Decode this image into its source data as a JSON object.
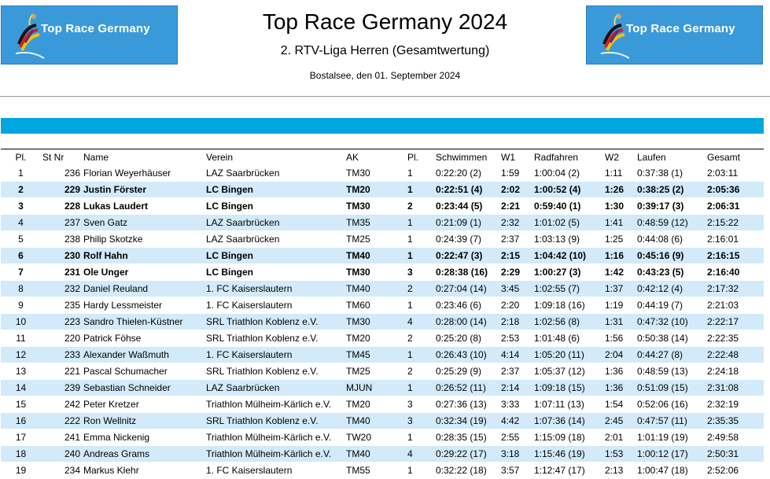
{
  "header": {
    "logo_text": "Top Race Germany",
    "title": "Top Race Germany 2024",
    "subtitle": "2. RTV-Liga Herren (Gesamtwertung)",
    "place_date": "Bostalsee, den 01. September 2024"
  },
  "columns": [
    "Pl.",
    "St Nr",
    "Name",
    "Verein",
    "AK",
    "Pl.",
    "Schwimmen",
    "W1",
    "Radfahren",
    "W2",
    "Laufen",
    "Gesamt"
  ],
  "rows": [
    {
      "pl": "1",
      "st": "236",
      "name": "Florian Weyerhäuser",
      "verein": "LAZ Saarbrücken",
      "ak": "TM30",
      "akpl": "1",
      "schwimmen": "0:22:20 (2)",
      "w1": "1:59",
      "rad": "1:00:04 (2)",
      "w2": "1:11",
      "laufen": "0:37:38 (1)",
      "gesamt": "2:03:11",
      "bold": false,
      "alt": false
    },
    {
      "pl": "2",
      "st": "229",
      "name": "Justin Förster",
      "verein": "LC Bingen",
      "ak": "TM20",
      "akpl": "1",
      "schwimmen": "0:22:51 (4)",
      "w1": "2:02",
      "rad": "1:00:52 (4)",
      "w2": "1:26",
      "laufen": "0:38:25 (2)",
      "gesamt": "2:05:36",
      "bold": true,
      "alt": true
    },
    {
      "pl": "3",
      "st": "228",
      "name": "Lukas Laudert",
      "verein": "LC Bingen",
      "ak": "TM30",
      "akpl": "2",
      "schwimmen": "0:23:44 (5)",
      "w1": "2:21",
      "rad": "0:59:40 (1)",
      "w2": "1:30",
      "laufen": "0:39:17 (3)",
      "gesamt": "2:06:31",
      "bold": true,
      "alt": false
    },
    {
      "pl": "4",
      "st": "237",
      "name": "Sven Gatz",
      "verein": "LAZ Saarbrücken",
      "ak": "TM35",
      "akpl": "1",
      "schwimmen": "0:21:09 (1)",
      "w1": "2:32",
      "rad": "1:01:02 (5)",
      "w2": "1:41",
      "laufen": "0:48:59 (12)",
      "gesamt": "2:15:22",
      "bold": false,
      "alt": true
    },
    {
      "pl": "5",
      "st": "238",
      "name": "Philip Skotzke",
      "verein": "LAZ Saarbrücken",
      "ak": "TM25",
      "akpl": "1",
      "schwimmen": "0:24:39 (7)",
      "w1": "2:37",
      "rad": "1:03:13 (9)",
      "w2": "1:25",
      "laufen": "0:44:08 (6)",
      "gesamt": "2:16:01",
      "bold": false,
      "alt": false
    },
    {
      "pl": "6",
      "st": "230",
      "name": "Rolf Hahn",
      "verein": "LC Bingen",
      "ak": "TM40",
      "akpl": "1",
      "schwimmen": "0:22:47 (3)",
      "w1": "2:15",
      "rad": "1:04:42 (10)",
      "w2": "1:16",
      "laufen": "0:45:16 (9)",
      "gesamt": "2:16:15",
      "bold": true,
      "alt": true
    },
    {
      "pl": "7",
      "st": "231",
      "name": "Ole Unger",
      "verein": "LC Bingen",
      "ak": "TM30",
      "akpl": "3",
      "schwimmen": "0:28:38 (16)",
      "w1": "2:29",
      "rad": "1:00:27 (3)",
      "w2": "1:42",
      "laufen": "0:43:23 (5)",
      "gesamt": "2:16:40",
      "bold": true,
      "alt": false
    },
    {
      "pl": "8",
      "st": "232",
      "name": "Daniel Reuland",
      "verein": "1. FC Kaiserslautern",
      "ak": "TM40",
      "akpl": "2",
      "schwimmen": "0:27:04 (14)",
      "w1": "3:45",
      "rad": "1:02:55 (7)",
      "w2": "1:37",
      "laufen": "0:42:12 (4)",
      "gesamt": "2:17:32",
      "bold": false,
      "alt": true
    },
    {
      "pl": "9",
      "st": "235",
      "name": "Hardy Lessmeister",
      "verein": "1. FC Kaiserslautern",
      "ak": "TM60",
      "akpl": "1",
      "schwimmen": "0:23:46 (6)",
      "w1": "2:20",
      "rad": "1:09:18 (16)",
      "w2": "1:19",
      "laufen": "0:44:19 (7)",
      "gesamt": "2:21:03",
      "bold": false,
      "alt": false
    },
    {
      "pl": "10",
      "st": "223",
      "name": "Sandro Thielen-Küstner",
      "verein": "SRL Triathlon Koblenz e.V.",
      "ak": "TM30",
      "akpl": "4",
      "schwimmen": "0:28:00 (14)",
      "w1": "2:18",
      "rad": "1:02:56 (8)",
      "w2": "1:31",
      "laufen": "0:47:32 (10)",
      "gesamt": "2:22:17",
      "bold": false,
      "alt": true
    },
    {
      "pl": "11",
      "st": "220",
      "name": "Patrick Föhse",
      "verein": "SRL Triathlon Koblenz e.V.",
      "ak": "TM20",
      "akpl": "2",
      "schwimmen": "0:25:20 (8)",
      "w1": "2:53",
      "rad": "1:01:48 (6)",
      "w2": "1:56",
      "laufen": "0:50:38 (14)",
      "gesamt": "2:22:35",
      "bold": false,
      "alt": false
    },
    {
      "pl": "12",
      "st": "233",
      "name": "Alexander Waßmuth",
      "verein": "1. FC Kaiserslautern",
      "ak": "TM45",
      "akpl": "1",
      "schwimmen": "0:26:43 (10)",
      "w1": "4:14",
      "rad": "1:05:20 (11)",
      "w2": "2:04",
      "laufen": "0:44:27 (8)",
      "gesamt": "2:22:48",
      "bold": false,
      "alt": true
    },
    {
      "pl": "13",
      "st": "221",
      "name": "Pascal Schumacher",
      "verein": "SRL Triathlon Koblenz e.V.",
      "ak": "TM25",
      "akpl": "2",
      "schwimmen": "0:25:29 (9)",
      "w1": "2:37",
      "rad": "1:05:37 (12)",
      "w2": "1:36",
      "laufen": "0:48:59 (13)",
      "gesamt": "2:24:18",
      "bold": false,
      "alt": false
    },
    {
      "pl": "14",
      "st": "239",
      "name": "Sebastian Schneider",
      "verein": "LAZ Saarbrücken",
      "ak": "MJUN",
      "akpl": "1",
      "schwimmen": "0:26:52 (11)",
      "w1": "2:14",
      "rad": "1:09:18 (15)",
      "w2": "1:36",
      "laufen": "0:51:09 (15)",
      "gesamt": "2:31:08",
      "bold": false,
      "alt": true
    },
    {
      "pl": "15",
      "st": "242",
      "name": "Peter Kretzer",
      "verein": "Triathlon Mülheim-Kärlich e.V.",
      "ak": "TM20",
      "akpl": "3",
      "schwimmen": "0:27:36 (13)",
      "w1": "3:33",
      "rad": "1:07:11 (13)",
      "w2": "1:54",
      "laufen": "0:52:06 (16)",
      "gesamt": "2:32:19",
      "bold": false,
      "alt": false
    },
    {
      "pl": "16",
      "st": "222",
      "name": "Ron Wellnitz",
      "verein": "SRL Triathlon Koblenz e.V.",
      "ak": "TM40",
      "akpl": "3",
      "schwimmen": "0:32:34 (19)",
      "w1": "4:42",
      "rad": "1:07:36 (14)",
      "w2": "2:45",
      "laufen": "0:47:57 (11)",
      "gesamt": "2:35:35",
      "bold": false,
      "alt": true
    },
    {
      "pl": "17",
      "st": "241",
      "name": "Emma Nickenig",
      "verein": "Triathlon Mülheim-Kärlich e.V.",
      "ak": "TW20",
      "akpl": "1",
      "schwimmen": "0:28:35 (15)",
      "w1": "2:55",
      "rad": "1:15:09 (18)",
      "w2": "2:01",
      "laufen": "1:01:19 (19)",
      "gesamt": "2:49:58",
      "bold": false,
      "alt": false
    },
    {
      "pl": "18",
      "st": "240",
      "name": "Andreas Grams",
      "verein": "Triathlon Mülheim-Kärlich e.V.",
      "ak": "TM40",
      "akpl": "4",
      "schwimmen": "0:29:22 (17)",
      "w1": "3:18",
      "rad": "1:15:46 (19)",
      "w2": "1:53",
      "laufen": "1:00:12 (17)",
      "gesamt": "2:50:31",
      "bold": false,
      "alt": true
    },
    {
      "pl": "19",
      "st": "234",
      "name": "Markus Klehr",
      "verein": "1. FC Kaiserslautern",
      "ak": "TM55",
      "akpl": "1",
      "schwimmen": "0:32:22 (18)",
      "w1": "3:57",
      "rad": "1:12:47 (17)",
      "w2": "2:13",
      "laufen": "1:00:47 (18)",
      "gesamt": "2:52:06",
      "bold": false,
      "alt": false
    }
  ]
}
